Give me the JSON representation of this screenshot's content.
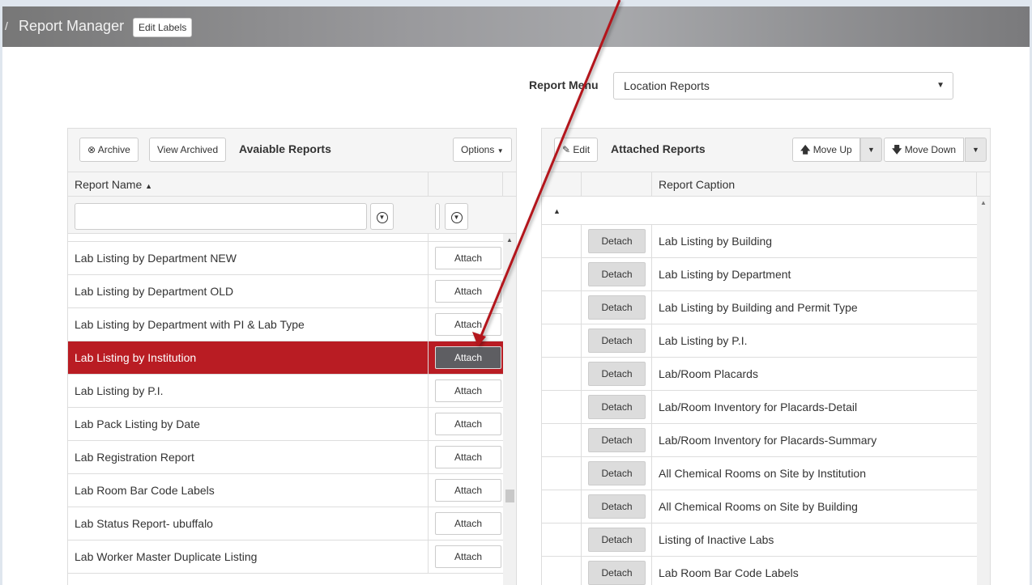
{
  "header": {
    "separator": "/",
    "title": "Report Manager",
    "edit_labels": "Edit Labels"
  },
  "report_menu": {
    "label": "Report Menu",
    "selected": "Location Reports"
  },
  "left_panel": {
    "archive_label": "Archive",
    "view_archived_label": "View Archived",
    "title": "Avaiable Reports",
    "options_label": "Options",
    "col_name": "Report Name",
    "filter_placeholder": "",
    "attach_label": "Attach",
    "rows": [
      "Lab Listing by Department NEW",
      "Lab Listing by Department OLD",
      "Lab Listing by Department with PI & Lab Type",
      "Lab Listing by Institution",
      "Lab Listing by P.I.",
      "Lab Pack Listing by Date",
      "Lab Registration Report",
      "Lab Room Bar Code Labels",
      "Lab Status Report- ubuffalo",
      "Lab Worker Master Duplicate Listing"
    ],
    "selected_index": 3
  },
  "right_panel": {
    "edit_label": "Edit",
    "title": "Attached Reports",
    "move_up_label": "Move Up",
    "move_down_label": "Move Down",
    "col_caption": "Report Caption",
    "detach_label": "Detach",
    "rows": [
      "Lab Listing by Building",
      "Lab Listing by Department",
      "Lab Listing by Building and Permit Type",
      "Lab Listing by P.I.",
      "Lab/Room Placards",
      "Lab/Room Inventory for Placards-Detail",
      "Lab/Room Inventory for Placards-Summary",
      "All Chemical Rooms on Site by Institution",
      "All Chemical Rooms on Site by Building",
      "Listing of Inactive Labs",
      "Lab Room Bar Code Labels"
    ]
  },
  "colors": {
    "selected_row": "#b91c23",
    "arrow": "#b3131b"
  },
  "icons": [
    "x-circle-icon",
    "caret-down-icon",
    "sort-up-icon",
    "filter-icon",
    "pencil-icon",
    "arrow-up-icon",
    "arrow-down-icon",
    "collapse-triangle-icon"
  ]
}
